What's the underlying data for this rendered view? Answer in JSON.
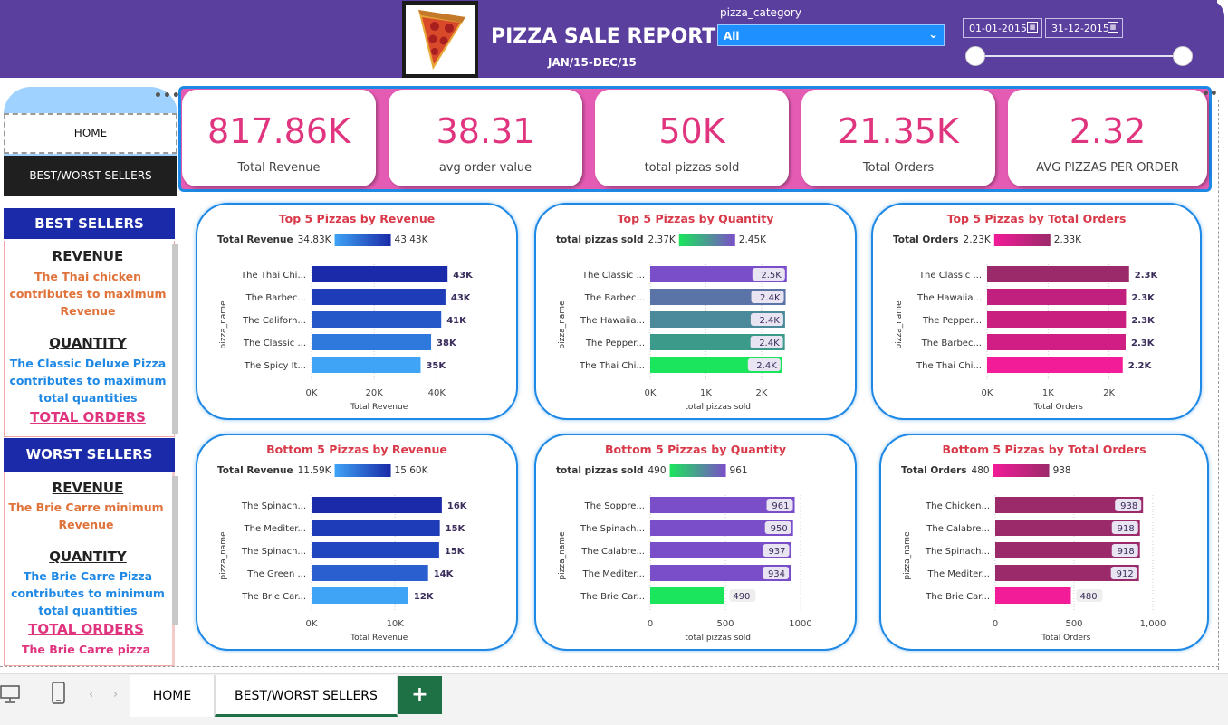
{
  "header": {
    "title": "PIZZA SALE REPORT",
    "subtitle": "JAN/15-DEC/15",
    "category_label": "pizza_category",
    "category_value": "All",
    "date_start": "01-01-2015",
    "date_end": "31-12-2015"
  },
  "nav": {
    "home": "HOME",
    "best_worst": "BEST/WORST SELLERS",
    "more": "•••"
  },
  "best_sellers": {
    "heading": "BEST SELLERS",
    "revenue_head": "REVENUE",
    "revenue_text": "The Thai chicken contributes to maximum Revenue",
    "quantity_head": "QUANTITY",
    "quantity_text": "The Classic Deluxe Pizza contributes to maximum total quantities",
    "orders_head": "TOTAL ORDERS"
  },
  "worst_sellers": {
    "heading": "WORST SELLERS",
    "revenue_head": "REVENUE",
    "revenue_text": "The Brie Carre  minimum Revenue",
    "quantity_head": "QUANTITY",
    "quantity_text": "The Brie Carre Pizza contributes to minimum total quantities",
    "orders_head": "TOTAL ORDERS",
    "orders_text": "The Brie Carre pizza"
  },
  "kpis": [
    {
      "value": "817.86K",
      "label": "Total Revenue"
    },
    {
      "value": "38.31",
      "label": "avg order value"
    },
    {
      "value": "50K",
      "label": "total pizzas sold"
    },
    {
      "value": "21.35K",
      "label": "Total Orders"
    },
    {
      "value": "2.32",
      "label": "AVG PIZZAS PER ORDER"
    }
  ],
  "colors": {
    "header": "#5b3f9e",
    "accent_pink": "#e0357e",
    "kpi_band": "#e45bb3",
    "border_blue": "#1e88e5",
    "title_red": "#d93a4a"
  },
  "chart_data": [
    {
      "type": "bar",
      "title": "Top 5 Pizzas by Revenue",
      "legend_label": "Total Revenue",
      "legend_min": "34.83K",
      "legend_max": "43.43K",
      "ylabel": "pizza_name",
      "xlabel": "Total Revenue",
      "categories": [
        "The Thai Chi...",
        "The Barbec...",
        "The Californ...",
        "The Classic ...",
        "The Spicy It..."
      ],
      "values": [
        43434,
        42768,
        41410,
        38180,
        34831
      ],
      "labels": [
        "43K",
        "43K",
        "41K",
        "38K",
        "35K"
      ],
      "ticks": [
        0,
        20000,
        40000
      ],
      "tick_labels": [
        "0K",
        "20K",
        "40K"
      ],
      "xmax": 48000,
      "label_style": "outside",
      "colors": [
        "#1a2aa8",
        "#1e3cb8",
        "#2557c9",
        "#2f78dc",
        "#3fa4f5"
      ]
    },
    {
      "type": "bar",
      "title": "Top 5 Pizzas by Quantity",
      "legend_label": "total pizzas sold",
      "legend_min": "2.37K",
      "legend_max": "2.45K",
      "ylabel": "pizza_name",
      "xlabel": "total pizzas sold",
      "categories": [
        "The Classic ...",
        "The Barbec...",
        "The Hawaiia...",
        "The Pepper...",
        "The Thai Chi..."
      ],
      "values": [
        2453,
        2432,
        2422,
        2418,
        2371
      ],
      "labels": [
        "2.5K",
        "2.4K",
        "2.4K",
        "2.4K",
        "2.4K"
      ],
      "ticks": [
        0,
        1000,
        2000
      ],
      "tick_labels": [
        "0K",
        "1K",
        "2K"
      ],
      "xmax": 2700,
      "label_style": "inside",
      "colors": [
        "#7b4ec9",
        "#5b74a8",
        "#4b8a9a",
        "#3c9a8a",
        "#1be55c"
      ]
    },
    {
      "type": "bar",
      "title": "Top 5 Pizzas by Total Orders",
      "legend_label": "Total Orders",
      "legend_min": "2.23K",
      "legend_max": "2.33K",
      "ylabel": "pizza_name",
      "xlabel": "Total Orders",
      "categories": [
        "The Classic ...",
        "The Hawaiia...",
        "The Pepper...",
        "The Barbec...",
        "The Thai Chi..."
      ],
      "values": [
        2329,
        2280,
        2278,
        2273,
        2225
      ],
      "labels": [
        "2.3K",
        "2.3K",
        "2.3K",
        "2.3K",
        "2.2K"
      ],
      "ticks": [
        0,
        1000,
        2000
      ],
      "tick_labels": [
        "0K",
        "1K",
        "2K"
      ],
      "xmax": 2600,
      "label_style": "outside",
      "colors": [
        "#9b2a6a",
        "#c2207e",
        "#c92080",
        "#d01e85",
        "#f21b98"
      ]
    },
    {
      "type": "bar",
      "title": "Bottom 5 Pizzas by Revenue",
      "legend_label": "Total Revenue",
      "legend_min": "11.59K",
      "legend_max": "15.60K",
      "ylabel": "pizza_name",
      "xlabel": "Total Revenue",
      "categories": [
        "The Spinach...",
        "The Mediter...",
        "The Spinach...",
        "The Green ...",
        "The Brie Car..."
      ],
      "values": [
        15600,
        15360,
        15277,
        13956,
        11588
      ],
      "labels": [
        "16K",
        "15K",
        "15K",
        "14K",
        "12K"
      ],
      "ticks": [
        0,
        10000
      ],
      "tick_labels": [
        "0K",
        "10K"
      ],
      "xmax": 18000,
      "label_style": "outside",
      "colors": [
        "#1a2aa8",
        "#1e3cb8",
        "#2147c0",
        "#2a5fd0",
        "#3fa4f5"
      ]
    },
    {
      "type": "bar",
      "title": "Bottom 5 Pizzas by Quantity",
      "legend_label": "total pizzas sold",
      "legend_min": "490",
      "legend_max": "961",
      "ylabel": "pizza_name",
      "xlabel": "total pizzas sold",
      "categories": [
        "The Soppre...",
        "The Spinach...",
        "The Calabre...",
        "The Mediter...",
        "The Brie Car..."
      ],
      "values": [
        961,
        950,
        937,
        934,
        490
      ],
      "labels": [
        "961",
        "950",
        "937",
        "934",
        "490"
      ],
      "ticks": [
        0,
        500,
        1000
      ],
      "tick_labels": [
        "0",
        "500",
        "1000"
      ],
      "xmax": 1000,
      "label_style": "inside",
      "colors": [
        "#7b4ec9",
        "#7b4ec9",
        "#7b4ec9",
        "#7b4ec9",
        "#1be55c"
      ]
    },
    {
      "type": "bar",
      "title": "Bottom 5 Pizzas by Total Orders",
      "legend_label": "Total Orders",
      "legend_min": "480",
      "legend_max": "938",
      "ylabel": "pizza_name",
      "xlabel": "Total Orders",
      "categories": [
        "The Chicken...",
        "The Calabre...",
        "The Spinach...",
        "The Mediter...",
        "The Brie Car..."
      ],
      "values": [
        938,
        918,
        918,
        912,
        480
      ],
      "labels": [
        "938",
        "918",
        "918",
        "912",
        "480"
      ],
      "ticks": [
        0,
        500,
        1000
      ],
      "tick_labels": [
        "0",
        "500",
        "1,000"
      ],
      "xmax": 1000,
      "label_style": "inside",
      "colors": [
        "#9b2a6a",
        "#9b2a6a",
        "#9b2a6a",
        "#9b2a6a",
        "#f21b98"
      ]
    }
  ],
  "tabs": {
    "home": "HOME",
    "best_worst": "BEST/WORST SELLERS",
    "add": "+"
  }
}
